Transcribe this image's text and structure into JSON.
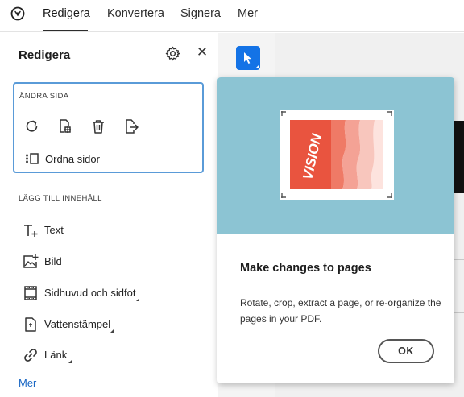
{
  "nav": {
    "tabs": [
      "Redigera",
      "Konvertera",
      "Signera",
      "Mer"
    ],
    "active_tab": "Redigera"
  },
  "panel": {
    "title": "Redigera",
    "settings_icon": "gear-icon",
    "close_icon": "close-icon",
    "change_page": {
      "section_label": "ÄNDRA SIDA",
      "tools": [
        "rotate-icon",
        "crop-page-icon",
        "delete-icon",
        "extract-page-icon"
      ],
      "organize_label": "Ordna sidor"
    },
    "add_content": {
      "section_label": "LÄGG TILL INNEHÅLL",
      "items": [
        {
          "label": "Text",
          "icon": "add-text-icon"
        },
        {
          "label": "Bild",
          "icon": "add-image-icon"
        },
        {
          "label": "Sidhuvud och sidfot",
          "icon": "header-footer-icon"
        },
        {
          "label": "Vattenstämpel",
          "icon": "watermark-icon"
        },
        {
          "label": "Länk",
          "icon": "link-icon"
        }
      ],
      "more_label": "Mer"
    }
  },
  "popover": {
    "thumbnail_text": "VISION",
    "title": "Make changes to pages",
    "body": "Rotate, crop, extract a page, or re-organize the pages in your PDF.",
    "ok_label": "OK"
  },
  "colors": {
    "accent": "#1473e6",
    "focus_border": "#5a9bd8",
    "popover_hero": "#8cc4d3",
    "thumb_red": "#e9543f",
    "link": "#1a67c4"
  }
}
